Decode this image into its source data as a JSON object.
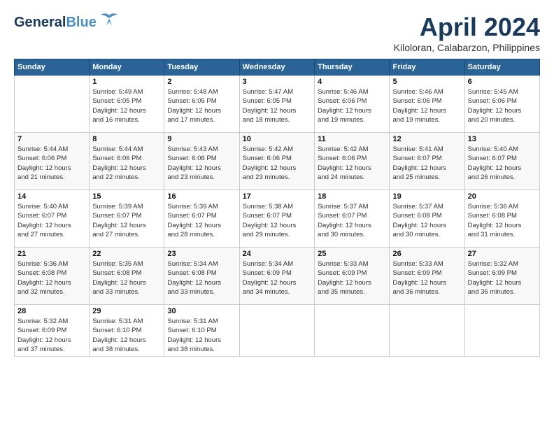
{
  "header": {
    "logo_line1": "General",
    "logo_line2": "Blue",
    "title": "April 2024",
    "subtitle": "Kiloloran, Calabarzon, Philippines"
  },
  "weekdays": [
    "Sunday",
    "Monday",
    "Tuesday",
    "Wednesday",
    "Thursday",
    "Friday",
    "Saturday"
  ],
  "weeks": [
    [
      {
        "day": "",
        "info": ""
      },
      {
        "day": "1",
        "info": "Sunrise: 5:49 AM\nSunset: 6:05 PM\nDaylight: 12 hours\nand 16 minutes."
      },
      {
        "day": "2",
        "info": "Sunrise: 5:48 AM\nSunset: 6:05 PM\nDaylight: 12 hours\nand 17 minutes."
      },
      {
        "day": "3",
        "info": "Sunrise: 5:47 AM\nSunset: 6:05 PM\nDaylight: 12 hours\nand 18 minutes."
      },
      {
        "day": "4",
        "info": "Sunrise: 5:46 AM\nSunset: 6:06 PM\nDaylight: 12 hours\nand 19 minutes."
      },
      {
        "day": "5",
        "info": "Sunrise: 5:46 AM\nSunset: 6:06 PM\nDaylight: 12 hours\nand 19 minutes."
      },
      {
        "day": "6",
        "info": "Sunrise: 5:45 AM\nSunset: 6:06 PM\nDaylight: 12 hours\nand 20 minutes."
      }
    ],
    [
      {
        "day": "7",
        "info": "Sunrise: 5:44 AM\nSunset: 6:06 PM\nDaylight: 12 hours\nand 21 minutes."
      },
      {
        "day": "8",
        "info": "Sunrise: 5:44 AM\nSunset: 6:06 PM\nDaylight: 12 hours\nand 22 minutes."
      },
      {
        "day": "9",
        "info": "Sunrise: 5:43 AM\nSunset: 6:06 PM\nDaylight: 12 hours\nand 23 minutes."
      },
      {
        "day": "10",
        "info": "Sunrise: 5:42 AM\nSunset: 6:06 PM\nDaylight: 12 hours\nand 23 minutes."
      },
      {
        "day": "11",
        "info": "Sunrise: 5:42 AM\nSunset: 6:06 PM\nDaylight: 12 hours\nand 24 minutes."
      },
      {
        "day": "12",
        "info": "Sunrise: 5:41 AM\nSunset: 6:07 PM\nDaylight: 12 hours\nand 25 minutes."
      },
      {
        "day": "13",
        "info": "Sunrise: 5:40 AM\nSunset: 6:07 PM\nDaylight: 12 hours\nand 26 minutes."
      }
    ],
    [
      {
        "day": "14",
        "info": "Sunrise: 5:40 AM\nSunset: 6:07 PM\nDaylight: 12 hours\nand 27 minutes."
      },
      {
        "day": "15",
        "info": "Sunrise: 5:39 AM\nSunset: 6:07 PM\nDaylight: 12 hours\nand 27 minutes."
      },
      {
        "day": "16",
        "info": "Sunrise: 5:39 AM\nSunset: 6:07 PM\nDaylight: 12 hours\nand 28 minutes."
      },
      {
        "day": "17",
        "info": "Sunrise: 5:38 AM\nSunset: 6:07 PM\nDaylight: 12 hours\nand 29 minutes."
      },
      {
        "day": "18",
        "info": "Sunrise: 5:37 AM\nSunset: 6:07 PM\nDaylight: 12 hours\nand 30 minutes."
      },
      {
        "day": "19",
        "info": "Sunrise: 5:37 AM\nSunset: 6:08 PM\nDaylight: 12 hours\nand 30 minutes."
      },
      {
        "day": "20",
        "info": "Sunrise: 5:36 AM\nSunset: 6:08 PM\nDaylight: 12 hours\nand 31 minutes."
      }
    ],
    [
      {
        "day": "21",
        "info": "Sunrise: 5:36 AM\nSunset: 6:08 PM\nDaylight: 12 hours\nand 32 minutes."
      },
      {
        "day": "22",
        "info": "Sunrise: 5:35 AM\nSunset: 6:08 PM\nDaylight: 12 hours\nand 33 minutes."
      },
      {
        "day": "23",
        "info": "Sunrise: 5:34 AM\nSunset: 6:08 PM\nDaylight: 12 hours\nand 33 minutes."
      },
      {
        "day": "24",
        "info": "Sunrise: 5:34 AM\nSunset: 6:09 PM\nDaylight: 12 hours\nand 34 minutes."
      },
      {
        "day": "25",
        "info": "Sunrise: 5:33 AM\nSunset: 6:09 PM\nDaylight: 12 hours\nand 35 minutes."
      },
      {
        "day": "26",
        "info": "Sunrise: 5:33 AM\nSunset: 6:09 PM\nDaylight: 12 hours\nand 36 minutes."
      },
      {
        "day": "27",
        "info": "Sunrise: 5:32 AM\nSunset: 6:09 PM\nDaylight: 12 hours\nand 36 minutes."
      }
    ],
    [
      {
        "day": "28",
        "info": "Sunrise: 5:32 AM\nSunset: 6:09 PM\nDaylight: 12 hours\nand 37 minutes."
      },
      {
        "day": "29",
        "info": "Sunrise: 5:31 AM\nSunset: 6:10 PM\nDaylight: 12 hours\nand 38 minutes."
      },
      {
        "day": "30",
        "info": "Sunrise: 5:31 AM\nSunset: 6:10 PM\nDaylight: 12 hours\nand 38 minutes."
      },
      {
        "day": "",
        "info": ""
      },
      {
        "day": "",
        "info": ""
      },
      {
        "day": "",
        "info": ""
      },
      {
        "day": "",
        "info": ""
      }
    ]
  ]
}
